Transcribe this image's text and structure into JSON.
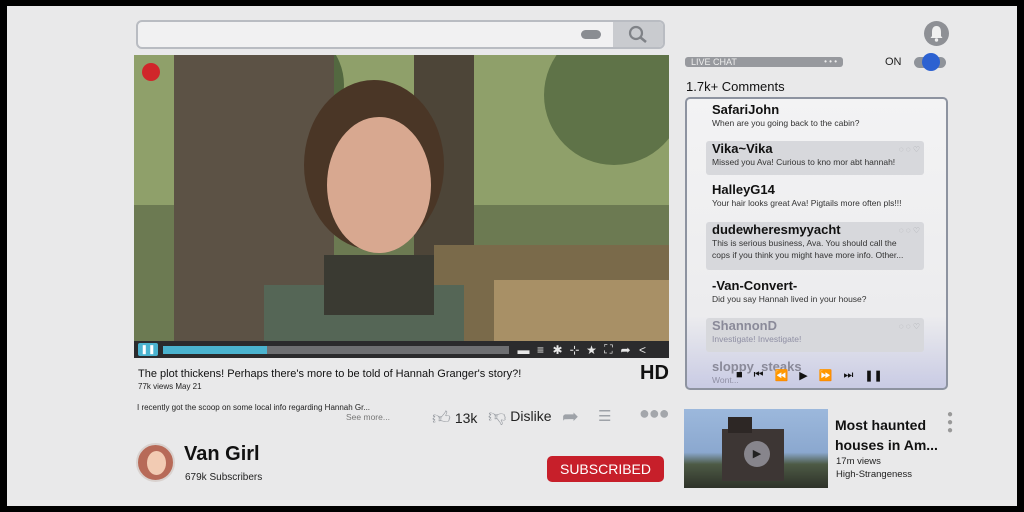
{
  "search": {
    "icon": "search-icon"
  },
  "notifications": {
    "icon": "bell-icon"
  },
  "video": {
    "recording_indicator_color": "#d0262a",
    "progress": 0.3,
    "control_icons": [
      "chat-icon",
      "menu-icon",
      "settings-icon",
      "resize-icon",
      "star-icon",
      "fullscreen-icon",
      "share-icon",
      "share-nodes-icon"
    ],
    "title": "The plot thickens! Perhaps there's more to be told of Hannah Granger's story?!",
    "meta": "77k views May 21",
    "quality": "HD",
    "description": "I recently got the scoop on some local info regarding Hannah Gr...",
    "see_more": "See more...",
    "likes": "13k",
    "dislike_label": "Dislike"
  },
  "channel": {
    "name": "Van Girl",
    "subscribers": "679k Subscribers",
    "subscribe_label": "SUBSCRIBED",
    "subscribe_color": "#c71f2a"
  },
  "live_chat": {
    "label": "LIVE CHAT",
    "toggle_label": "ON",
    "toggle_on": true,
    "accent": "#2c61d1",
    "comments_count": "1.7k+ Comments",
    "messages": [
      {
        "user": "SafariJohn",
        "text": "When are you going back to the cabin?"
      },
      {
        "user": "Vika~Vika",
        "text": "Missed you Ava! Curious to kno mor abt hannah!"
      },
      {
        "user": "HalleyG14",
        "text": "Your hair looks great Ava! Pigtails more often pls!!!"
      },
      {
        "user": "dudewheresmyyacht",
        "text": "This is serious business, Ava. You should call the",
        "text2": "cops if you think you might have more info. Other..."
      },
      {
        "user": "-Van-Convert-",
        "text": "Did you say Hannah lived in your house?"
      },
      {
        "user": "ShannonD",
        "text": "Investigate! Investigate!"
      },
      {
        "user": "sloppy_steaks",
        "text": "Wont..."
      }
    ]
  },
  "suggested": {
    "title": "Most haunted houses in Am...",
    "views": "17m views",
    "channel": "High-Strangeness"
  }
}
